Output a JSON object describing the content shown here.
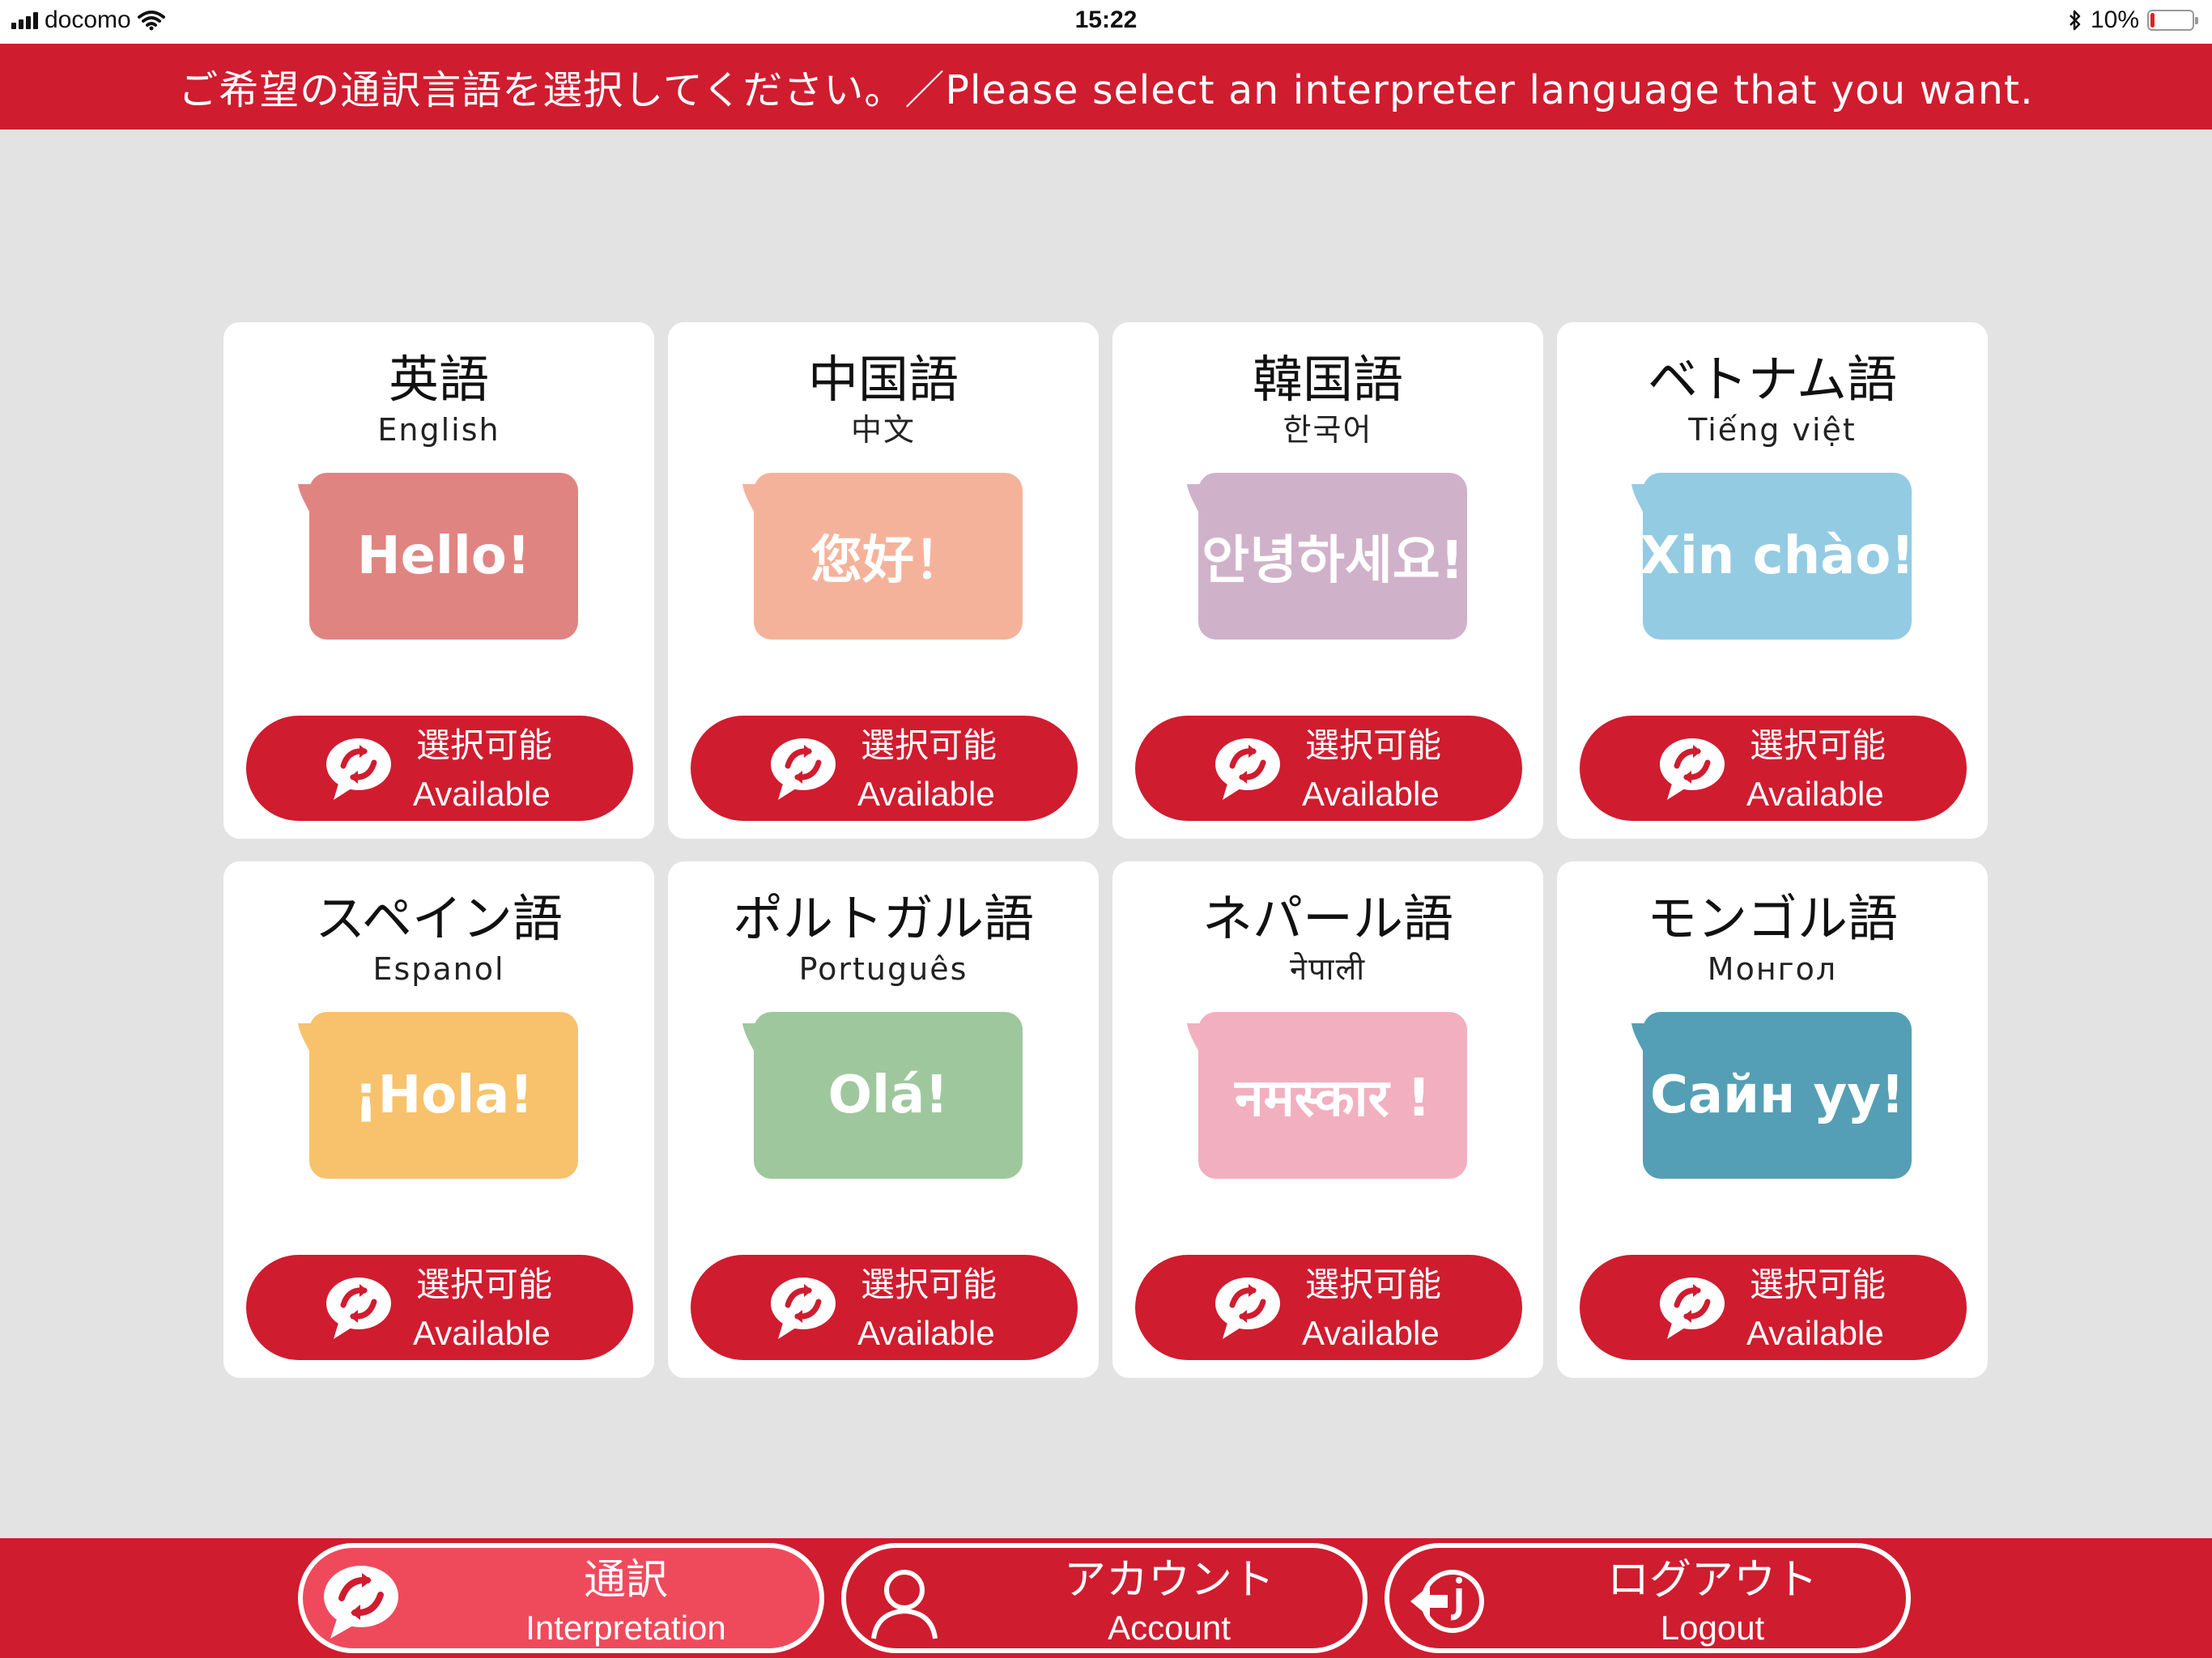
{
  "status_bar": {
    "carrier": "docomo",
    "time": "15:22",
    "battery_text": "10%",
    "battery_level": 0.1,
    "icons": [
      "signal-icon",
      "wifi-icon",
      "bluetooth-icon",
      "battery-icon"
    ]
  },
  "header": {
    "prompt": "ご希望の通訳言語を選択してください。／Please select an interpreter language that you want."
  },
  "available_jp": "選択可能",
  "available_en": "Available",
  "languages": [
    {
      "title": "英語",
      "native": "English",
      "greeting": "Hello!",
      "color": "#e08482"
    },
    {
      "title": "中国語",
      "native": "中文",
      "greeting": "您好！",
      "color": "#f5b29a"
    },
    {
      "title": "韓国語",
      "native": "한국어",
      "greeting": "안녕하세요!",
      "color": "#d0b1ca"
    },
    {
      "title": "ベトナム語",
      "native": "Tiếng việt",
      "greeting": "Xin chào!",
      "color": "#93cbe3"
    },
    {
      "title": "スペイン語",
      "native": "Espanol",
      "greeting": "¡Hola!",
      "color": "#f7c26b"
    },
    {
      "title": "ポルトガル語",
      "native": "Português",
      "greeting": "Olá!",
      "color": "#9fc79d"
    },
    {
      "title": "ネパール語",
      "native": "नेपाली",
      "greeting": "नमस्कार !",
      "color": "#f2afbf"
    },
    {
      "title": "モンゴル語",
      "native": "Монгол",
      "greeting": "Сайн уу!",
      "color": "#549fb5"
    }
  ],
  "footer": {
    "nav": [
      {
        "jp": "通訳",
        "en": "Interpretation",
        "icon": "interpretation-icon",
        "active": true
      },
      {
        "jp": "アカウント",
        "en": "Account",
        "icon": "account-icon",
        "active": false
      },
      {
        "jp": "ログアウト",
        "en": "Logout",
        "icon": "logout-icon",
        "active": false
      }
    ]
  },
  "colors": {
    "brand_red": "#d01c2f",
    "active_nav": "#ef4a5c",
    "background": "#e3e3e3"
  }
}
